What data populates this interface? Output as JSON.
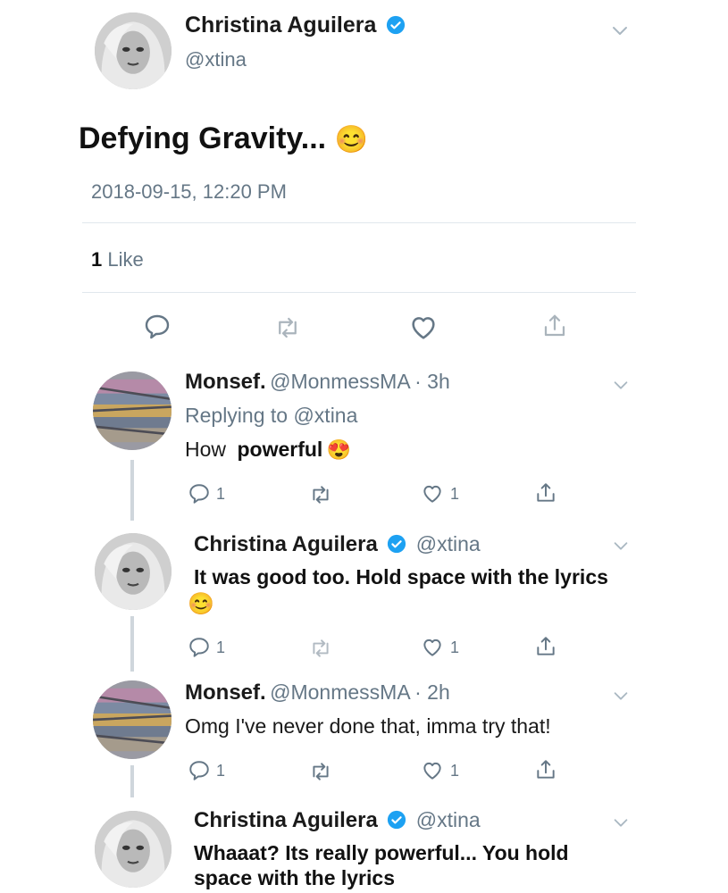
{
  "main_tweet": {
    "author_name": "Christina Aguilera",
    "author_handle": "@xtina",
    "text": "Defying Gravity...",
    "emoji": "😊",
    "timestamp": "2018-09-15, 12:20 PM",
    "likes_count": "1",
    "likes_label": "Like"
  },
  "replies": [
    {
      "author_name": "Monsef.",
      "author_handle": "@MonmessMA",
      "time": "· 3h",
      "replying_to": "Replying to @xtina",
      "text_prefix": "How",
      "text_bold": "powerful",
      "emoji": "😍",
      "reply_count": "1",
      "like_count": "1"
    },
    {
      "author_name": "Christina Aguilera",
      "author_handle": "@xtina",
      "text": "It was good too. Hold space with the lyrics",
      "emoji": "😊",
      "reply_count": "1",
      "like_count": "1"
    },
    {
      "author_name": "Monsef.",
      "author_handle": "@MonmessMA",
      "time": "· 2h",
      "text": "Omg I've never done that, imma try that!",
      "reply_count": "1",
      "like_count": "1"
    },
    {
      "author_name": "Christina Aguilera",
      "author_handle": "@xtina",
      "text_line1": "Whaaat? Its really powerful... You hold",
      "text_line2": "space with the lyrics"
    }
  ],
  "colors": {
    "verified": "#1da1f2",
    "gray_text": "#657786",
    "divider": "#e1e8ed"
  },
  "icons": [
    "reply-icon",
    "retweet-icon",
    "like-icon",
    "share-icon",
    "verified-icon",
    "chevron-down-icon"
  ]
}
